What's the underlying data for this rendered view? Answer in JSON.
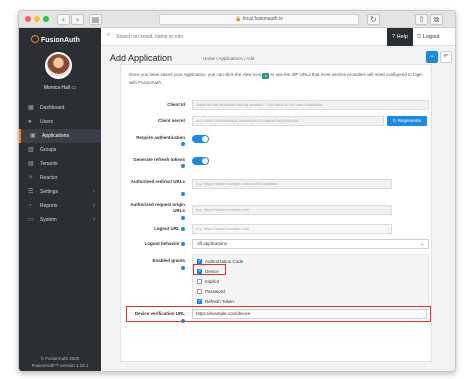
{
  "browser": {
    "url": "local.fusionauth.io"
  },
  "sidebar": {
    "brand": "FusionAuth",
    "user_name": "Monica Hall",
    "items": [
      {
        "label": "Dashboard",
        "icon": "dashboard-icon"
      },
      {
        "label": "Users",
        "icon": "users-icon"
      },
      {
        "label": "Applications",
        "icon": "applications-icon",
        "active": true
      },
      {
        "label": "Groups",
        "icon": "groups-icon"
      },
      {
        "label": "Tenants",
        "icon": "tenants-icon"
      },
      {
        "label": "Reactor",
        "icon": "reactor-icon"
      },
      {
        "label": "Settings",
        "icon": "settings-icon",
        "chevron": true
      },
      {
        "label": "Reports",
        "icon": "reports-icon",
        "chevron": true
      },
      {
        "label": "System",
        "icon": "system-icon",
        "chevron": true
      }
    ],
    "footer_copyright": "© FusionAuth 2020",
    "footer_version": "FusionAuth™ version 1.18.1"
  },
  "topbar": {
    "search_placeholder": "Search on email, name or role",
    "help": "Help",
    "logout": "Logout"
  },
  "header": {
    "title": "Add Application",
    "breadcrumb": "Home  /  Applications  /  Add"
  },
  "form": {
    "intro_pre": "Once you have saved your Application, you can click the view icon",
    "intro_post": "to see the IdP URLs that most service providers will need configured to login with FusionAuth.",
    "client_id_label": "Client Id",
    "client_id_value": "Value will be defaulted during creation. This value is not user modifiable.",
    "client_secret_label": "Client secret",
    "client_secret_value": "urGL4BrPD0lSGbvNhA-NwHnO9HTUAaphzTyKjXH6e9M",
    "regenerate": "Regenerate",
    "require_auth_label": "Require authentication",
    "generate_refresh_label": "Generate refresh tokens",
    "redirect_label": "Authorized redirect URLs",
    "redirect_placeholder": "e.g. https://www.example.com/oauth2/callback",
    "origin_label": "Authorized request origin URLs",
    "origin_placeholder": "e.g. https://www.example.com",
    "logout_url_label": "Logout URL",
    "logout_url_placeholder": "e.g. https://www.example.com",
    "logout_behavior_label": "Logout behavior",
    "logout_behavior_value": "All applications",
    "grants_label": "Enabled grants",
    "grants": [
      {
        "label": "Authorization Code",
        "checked": true
      },
      {
        "label": "Device",
        "checked": true
      },
      {
        "label": "Implicit",
        "checked": false
      },
      {
        "label": "Password",
        "checked": false
      },
      {
        "label": "Refresh Token",
        "checked": true
      }
    ],
    "device_url_label": "Device verification URL",
    "device_url_value": "https://example.com/device"
  },
  "colors": {
    "accent": "#1e88e5",
    "highlight": "#e03131",
    "sidebar": "#2b2e33",
    "brand": "#f58320"
  }
}
